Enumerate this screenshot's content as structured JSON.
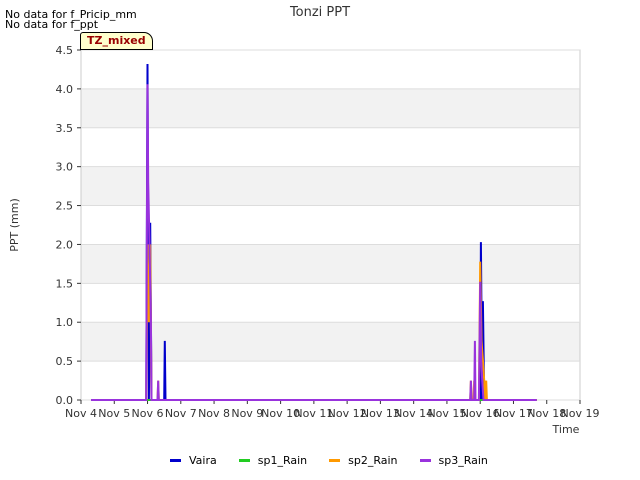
{
  "notices": [
    "No data for f_Pricip_mm",
    "No data for f_ppt"
  ],
  "badge": "TZ_mixed",
  "chart_data": {
    "type": "line",
    "title": "Tonzi PPT",
    "xlabel": "Time",
    "ylabel": "PPT (mm)",
    "xlim": [
      4,
      19
    ],
    "ylim": [
      0,
      4.5
    ],
    "x_ticks": [
      4,
      5,
      6,
      7,
      8,
      9,
      10,
      11,
      12,
      13,
      14,
      15,
      16,
      17,
      18,
      19
    ],
    "x_tick_labels": [
      "Nov 4",
      "Nov 5",
      "Nov 6",
      "Nov 7",
      "Nov 8",
      "Nov 9",
      "Nov 10",
      "Nov 11",
      "Nov 12",
      "Nov 13",
      "Nov 14",
      "Nov 15",
      "Nov 16",
      "Nov 17",
      "Nov 18",
      "Nov 19"
    ],
    "y_ticks": [
      0.0,
      0.5,
      1.0,
      1.5,
      2.0,
      2.5,
      3.0,
      3.5,
      4.0,
      4.5
    ],
    "y_tick_labels": [
      "0.0",
      "0.5",
      "1.0",
      "1.5",
      "2.0",
      "2.5",
      "3.0",
      "3.5",
      "4.0",
      "4.5"
    ],
    "grid": "horizontal bands",
    "legend_position": "bottom",
    "series": [
      {
        "name": "Vaira",
        "color": "#0000cc",
        "points": [
          [
            4.3,
            0
          ],
          [
            5.96,
            0
          ],
          [
            6.0,
            4.32
          ],
          [
            6.04,
            0
          ],
          [
            6.08,
            2.28
          ],
          [
            6.12,
            0
          ],
          [
            6.5,
            0
          ],
          [
            6.52,
            0.76
          ],
          [
            6.54,
            0
          ],
          [
            15.8,
            0
          ],
          [
            15.85,
            0
          ],
          [
            15.9,
            0
          ],
          [
            16.0,
            0
          ],
          [
            16.02,
            2.03
          ],
          [
            16.06,
            0
          ],
          [
            16.08,
            1.27
          ],
          [
            16.12,
            0
          ],
          [
            17.7,
            0
          ]
        ]
      },
      {
        "name": "sp1_Rain",
        "color": "#22cc22",
        "points": [
          [
            4.3,
            0
          ],
          [
            17.7,
            0
          ]
        ]
      },
      {
        "name": "sp2_Rain",
        "color": "#ff9900",
        "points": [
          [
            4.3,
            0
          ],
          [
            5.96,
            0
          ],
          [
            6.0,
            2.0
          ],
          [
            6.04,
            1.0
          ],
          [
            6.08,
            2.0
          ],
          [
            6.12,
            0
          ],
          [
            6.3,
            0
          ],
          [
            6.32,
            0.25
          ],
          [
            6.34,
            0
          ],
          [
            15.7,
            0
          ],
          [
            15.72,
            0.25
          ],
          [
            15.74,
            0
          ],
          [
            15.8,
            0
          ],
          [
            15.82,
            0.25
          ],
          [
            15.84,
            0
          ],
          [
            15.96,
            0
          ],
          [
            16.0,
            1.78
          ],
          [
            16.04,
            0.76
          ],
          [
            16.08,
            0.51
          ],
          [
            16.12,
            0.25
          ],
          [
            16.14,
            0
          ],
          [
            16.18,
            0.25
          ],
          [
            16.2,
            0
          ],
          [
            17.7,
            0
          ]
        ]
      },
      {
        "name": "sp3_Rain",
        "color": "#9933dd",
        "points": [
          [
            4.3,
            0
          ],
          [
            5.96,
            0
          ],
          [
            6.0,
            4.06
          ],
          [
            6.02,
            2.8
          ],
          [
            6.06,
            2.0
          ],
          [
            6.1,
            1.0
          ],
          [
            6.12,
            0
          ],
          [
            6.3,
            0
          ],
          [
            6.32,
            0.25
          ],
          [
            6.34,
            0
          ],
          [
            15.7,
            0
          ],
          [
            15.72,
            0.25
          ],
          [
            15.74,
            0
          ],
          [
            15.82,
            0
          ],
          [
            15.84,
            0.76
          ],
          [
            15.86,
            0
          ],
          [
            15.96,
            0
          ],
          [
            16.0,
            1.52
          ],
          [
            16.03,
            0.51
          ],
          [
            16.06,
            0.25
          ],
          [
            16.1,
            0
          ],
          [
            17.7,
            0
          ]
        ]
      }
    ]
  }
}
